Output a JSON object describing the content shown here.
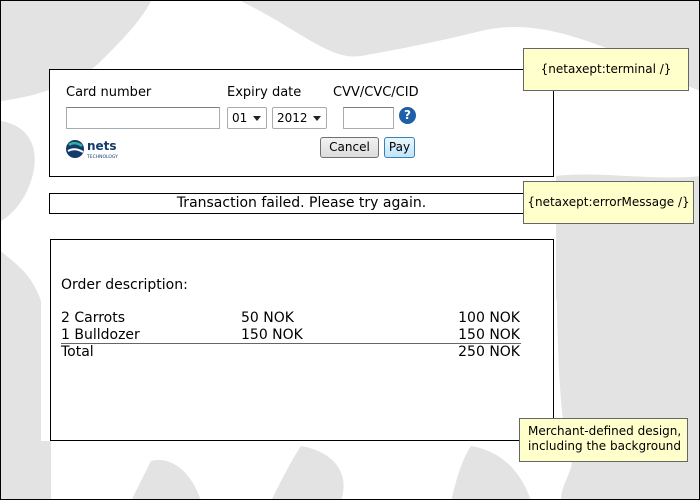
{
  "terminal": {
    "card_number_label": "Card number",
    "card_number_value": "",
    "expiry_label": "Expiry date",
    "expiry_month": "01",
    "expiry_year": "2012",
    "cvv_label": "CVV/CVC/CID",
    "cvv_value": "",
    "help_glyph": "?",
    "cancel_label": "Cancel",
    "pay_label": "Pay",
    "logo_text": "nets",
    "logo_subtext": "TECHNOLOGY"
  },
  "error": {
    "message": "Transaction failed. Please try again."
  },
  "order": {
    "heading": "Order description:",
    "items": [
      {
        "name": "2 Carrots",
        "unit_price": "50 NOK",
        "total": "100 NOK"
      },
      {
        "name": "1 Bulldozer",
        "unit_price": "150 NOK",
        "total": "150 NOK"
      }
    ],
    "total_label": "Total",
    "total_value": "250 NOK"
  },
  "callouts": {
    "terminal": "{netaxept:terminal /}",
    "error": "{netaxept:errorMessage /}",
    "merchant_line1": "Merchant-defined design,",
    "merchant_line2": "including the background"
  },
  "colors": {
    "map_sea": "#ffffff",
    "map_land": "#e3e3e3",
    "callout_bg": "#ffffcc",
    "help_icon": "#1d5fa8",
    "logo_primary": "#123a6b",
    "logo_accent": "#2fb09c"
  }
}
